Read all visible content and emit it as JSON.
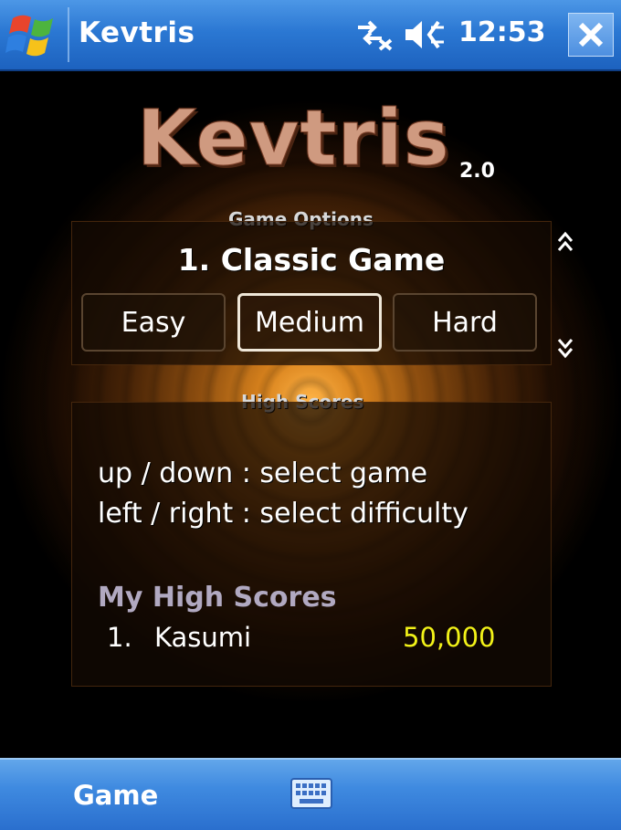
{
  "titlebar": {
    "app_title": "Kevtris",
    "clock": "12:53",
    "icons": [
      "windows-start-icon",
      "connectivity-icon",
      "volume-icon",
      "close-icon"
    ]
  },
  "logo": {
    "text": "Kevtris",
    "version": "2.0"
  },
  "game_options": {
    "label": "Game Options",
    "selected_game": "1. Classic Game",
    "difficulties": [
      "Easy",
      "Medium",
      "Hard"
    ],
    "selected_difficulty": "Medium"
  },
  "high_scores": {
    "label": "High Scores",
    "help_lines": [
      "up / down : select game",
      "left / right : select difficulty"
    ],
    "heading": "My High Scores",
    "entries": [
      {
        "rank": "1.",
        "name": "Kasumi",
        "score": "50,000"
      }
    ]
  },
  "menubar": {
    "left_softkey": "Game",
    "keyboard_icon": "keyboard-icon"
  },
  "colors": {
    "titlebar_blue": "#2b78d3",
    "score_yellow": "#f2f218",
    "heading_lavender": "#b1a9c1",
    "logo_pink": "#cf9a80"
  }
}
